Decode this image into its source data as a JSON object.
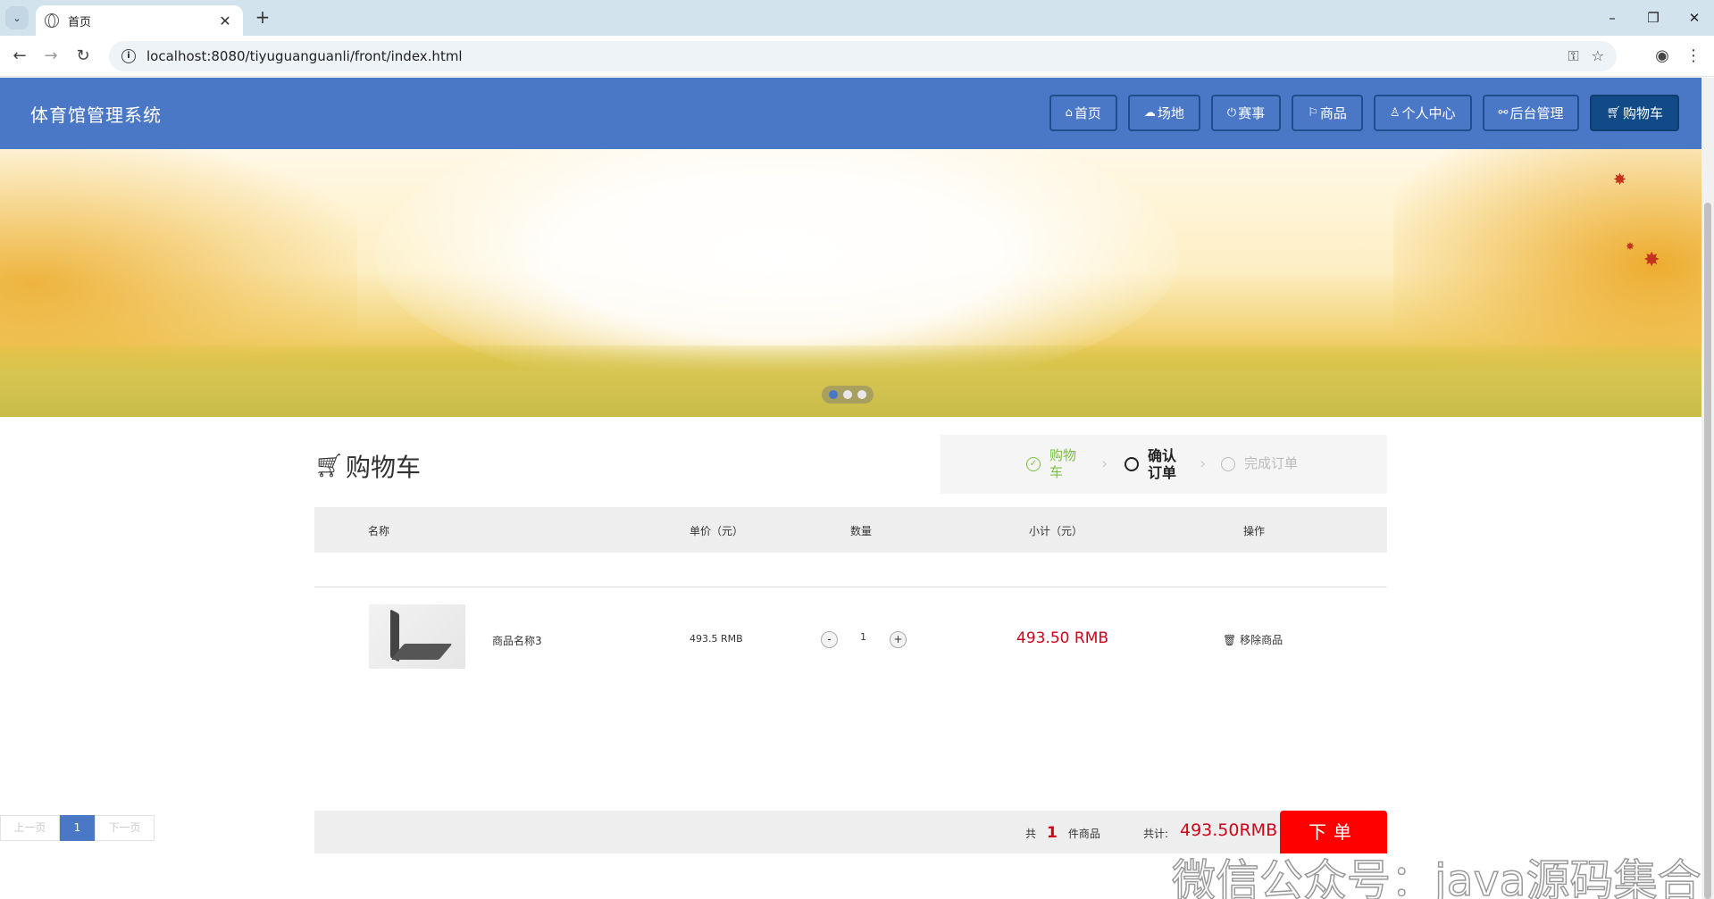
{
  "browser": {
    "tab_title": "首页",
    "url": "localhost:8080/tiyuguanguanli/front/index.html"
  },
  "site": {
    "title": "体育馆管理系统",
    "nav": [
      {
        "label": "首页",
        "icon": "home-icon"
      },
      {
        "label": "场地",
        "icon": "cloud-icon"
      },
      {
        "label": "赛事",
        "icon": "power-icon"
      },
      {
        "label": "商品",
        "icon": "flag-icon"
      },
      {
        "label": "个人中心",
        "icon": "user-icon"
      },
      {
        "label": "后台管理",
        "icon": "link-icon"
      },
      {
        "label": "购物车",
        "icon": "cart-icon",
        "active": true
      }
    ]
  },
  "carousel": {
    "dot_count": 3,
    "active_index": 0
  },
  "cart": {
    "title": "购物车",
    "steps": {
      "done": "购物车",
      "current": "确认订单",
      "todo": "完成订单"
    },
    "columns": [
      "名称",
      "单价（元）",
      "数量",
      "小计（元）",
      "操作"
    ],
    "items": [
      {
        "name": "商品名称3",
        "price": "493.5 RMB",
        "qty_minus": "-",
        "quantity": "1",
        "qty_plus": "+",
        "subtotal": "493.50 RMB",
        "remove": "移除商品"
      }
    ],
    "pager": {
      "prev": "上一页",
      "page": "1",
      "next": "下一页"
    },
    "summary": {
      "count_prefix": "共",
      "count": "1",
      "count_suffix": "件商品",
      "total_label": "共计:",
      "total": "493.50RMB",
      "order_button": "下单"
    }
  },
  "watermark": "微信公众号：java源码集合",
  "colors": {
    "header": "#4a78c6",
    "price": "#d0021b",
    "order_button": "#ff0000",
    "step_done": "#7ac142"
  }
}
